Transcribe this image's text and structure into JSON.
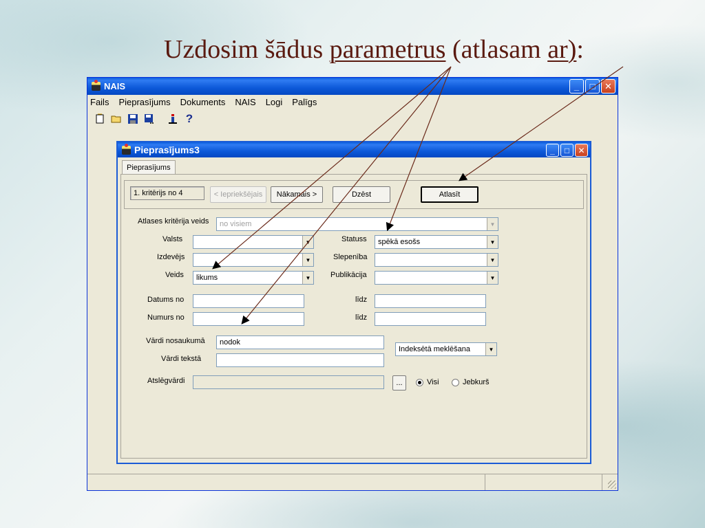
{
  "slide": {
    "title_prefix": "Uzdosim šādus ",
    "title_link1": "parametrus",
    "title_middle": " (atlasam ",
    "title_link2": "ar)",
    "title_suffix": ":"
  },
  "app": {
    "title": "NAIS",
    "menu": [
      "Fails",
      "Pieprasījums",
      "Dokuments",
      "NAIS",
      "Logi",
      "Palīgs"
    ]
  },
  "child": {
    "title": "Pieprasījums3",
    "tab": "Pieprasījums",
    "criteria": "1. kritērijs no 4",
    "btn_prev": "< Iepriekšējais",
    "btn_next": "Nākamais >",
    "btn_delete": "Dzēst",
    "btn_select": "Atlasīt",
    "labels": {
      "criteria_type": "Atlases kritērija veids",
      "country": "Valsts",
      "issuer": "Izdevējs",
      "kind": "Veids",
      "status": "Statuss",
      "secrecy": "Slepenība",
      "publication": "Publikācija",
      "date_from": "Datums no",
      "date_to": "līdz",
      "number_from": "Numurs no",
      "number_to": "līdz",
      "words_title": "Vārdi nosaukumā",
      "words_text": "Vārdi tekstā",
      "keywords": "Atslēgvārdi"
    },
    "values": {
      "criteria_type": "no visiem",
      "kind": "likums",
      "status": "spēkā esošs",
      "words_title": "nodok",
      "search_mode": "Indeksētā meklēšana"
    },
    "browse": "...",
    "radio_all": "Visi",
    "radio_any": "Jebkurš"
  }
}
